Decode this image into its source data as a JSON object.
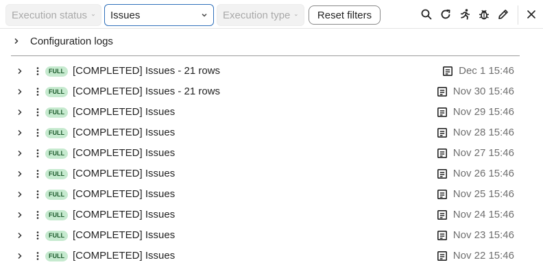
{
  "toolbar": {
    "execution_status": {
      "label": "Execution status",
      "disabled": true
    },
    "query": {
      "label": "Issues"
    },
    "execution_type": {
      "label": "Execution type",
      "disabled": true
    },
    "reset_label": "Reset filters",
    "icons": [
      "search-icon",
      "refresh-icon",
      "run-icon",
      "bug-icon",
      "edit-icon",
      "close-icon"
    ]
  },
  "config_logs": {
    "label": "Configuration logs"
  },
  "colors": {
    "badge_bg": "#c6eacf",
    "badge_text": "#1d5b2c",
    "active_border": "#2f6fba"
  },
  "rows": [
    {
      "badge": "FULL",
      "title": "[COMPLETED] Issues - 21 rows",
      "date": "Dec 1 15:46"
    },
    {
      "badge": "FULL",
      "title": "[COMPLETED] Issues - 21 rows",
      "date": "Nov 30 15:46"
    },
    {
      "badge": "FULL",
      "title": "[COMPLETED] Issues",
      "date": "Nov 29 15:46"
    },
    {
      "badge": "FULL",
      "title": "[COMPLETED] Issues",
      "date": "Nov 28 15:46"
    },
    {
      "badge": "FULL",
      "title": "[COMPLETED] Issues",
      "date": "Nov 27 15:46"
    },
    {
      "badge": "FULL",
      "title": "[COMPLETED] Issues",
      "date": "Nov 26 15:46"
    },
    {
      "badge": "FULL",
      "title": "[COMPLETED] Issues",
      "date": "Nov 25 15:46"
    },
    {
      "badge": "FULL",
      "title": "[COMPLETED] Issues",
      "date": "Nov 24 15:46"
    },
    {
      "badge": "FULL",
      "title": "[COMPLETED] Issues",
      "date": "Nov 23 15:46"
    },
    {
      "badge": "FULL",
      "title": "[COMPLETED] Issues",
      "date": "Nov 22 15:46"
    }
  ]
}
